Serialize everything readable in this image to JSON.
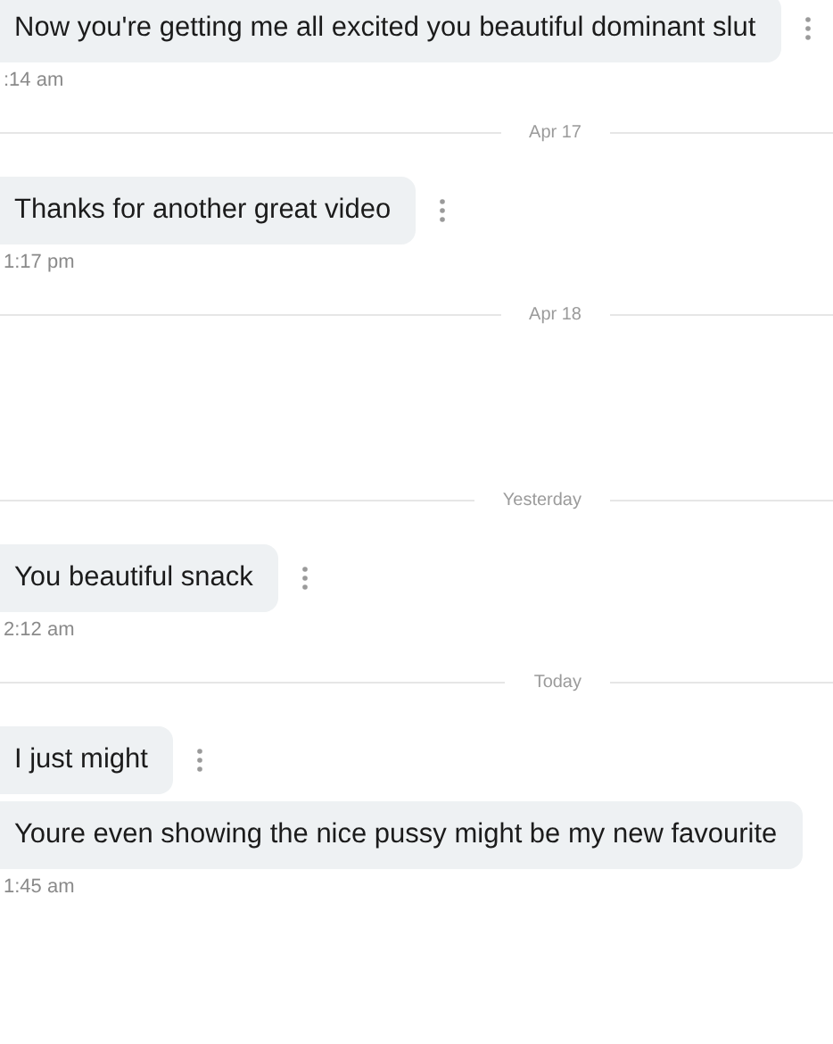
{
  "items": [
    {
      "kind": "message",
      "text": "Now you're getting me all excited you beautiful dominant slut",
      "time": ":14 am",
      "menu": true
    },
    {
      "kind": "divider",
      "label": "Apr 17"
    },
    {
      "kind": "message",
      "text": "Thanks for another great video",
      "time": "1:17 pm",
      "menu": true
    },
    {
      "kind": "divider",
      "label": "Apr 18"
    },
    {
      "kind": "divider",
      "label": "Yesterday"
    },
    {
      "kind": "message",
      "text": "You beautiful snack",
      "time": "2:12 am",
      "menu": true
    },
    {
      "kind": "divider",
      "label": "Today"
    },
    {
      "kind": "message",
      "text": "I just might",
      "menu": true
    },
    {
      "kind": "message",
      "text": "Youre even showing the nice pussy might be my new favourite",
      "time": "1:45 am",
      "menu": false
    }
  ]
}
